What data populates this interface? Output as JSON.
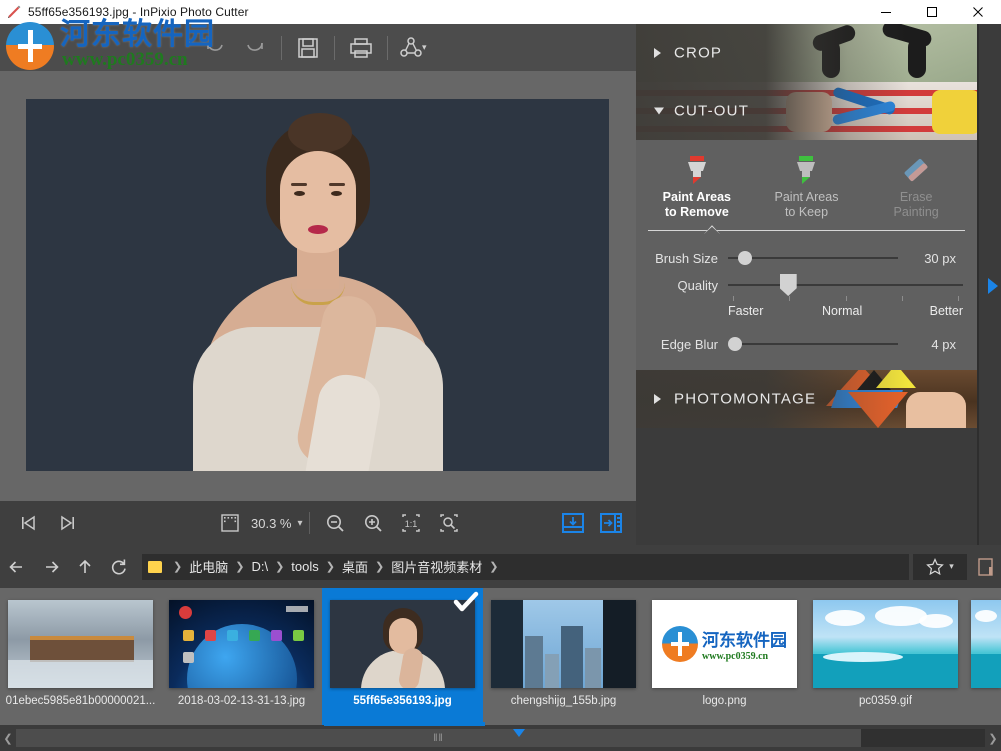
{
  "window": {
    "title": "55ff65e356193.jpg - InPixio Photo Cutter",
    "app_icon": "pencil-icon",
    "minimize": "—",
    "maximize": "□",
    "close": "✕"
  },
  "watermark": {
    "cn_text": "河东软件园",
    "url_text": "www.pc0359.cn"
  },
  "toolbar": {
    "items": [
      {
        "name": "undo-button",
        "label": "Undo",
        "icon": "undo-arrow-icon",
        "disabled": true
      },
      {
        "name": "redo-button",
        "label": "Redo",
        "icon": "redo-arrow-icon",
        "disabled": true
      },
      {
        "name": "save-button",
        "label": "Save",
        "icon": "floppy-disk-icon",
        "disabled": false
      },
      {
        "name": "print-button",
        "label": "Print",
        "icon": "printer-icon",
        "disabled": false
      },
      {
        "name": "share-button",
        "label": "Share",
        "icon": "share-nodes-icon",
        "disabled": false
      }
    ]
  },
  "canvas_toolbar": {
    "first_image_label": "First image",
    "next_image_label": "Next image",
    "fit_label": "Fit to window",
    "zoom_value": "30.3 %",
    "zoom_dropdown_caret": "▾",
    "zoom_out_label": "Zoom out",
    "zoom_in_label": "Zoom in",
    "actual_size_label": "1:1",
    "zoom_selection_label": "Zoom to selection",
    "export_label": "Export image",
    "compare_label": "Side by side compare"
  },
  "right_panel": {
    "sections": [
      {
        "id": "crop",
        "title": "CROP",
        "expanded": false,
        "arrow": "chevron-right-icon"
      },
      {
        "id": "cutout",
        "title": "CUT-OUT",
        "expanded": true,
        "arrow": "chevron-down-icon"
      },
      {
        "id": "photomontage",
        "title": "PHOTOMONTAGE",
        "expanded": false,
        "arrow": "chevron-right-icon"
      }
    ],
    "cutout": {
      "tools": [
        {
          "id": "paint-remove",
          "line1": "Paint Areas",
          "line2": "to Remove",
          "state": "active",
          "icon": "marker-red-icon"
        },
        {
          "id": "paint-keep",
          "line1": "Paint Areas",
          "line2": "to Keep",
          "state": "normal",
          "icon": "marker-green-icon"
        },
        {
          "id": "erase-painting",
          "line1": "Erase",
          "line2": "Painting",
          "state": "disabled",
          "icon": "eraser-icon"
        }
      ],
      "sliders": [
        {
          "id": "brush-size",
          "label": "Brush Size",
          "value": "30 px",
          "percent": 8,
          "style": "round"
        },
        {
          "id": "quality",
          "label": "Quality",
          "value": "",
          "percent": 24,
          "style": "pentagon"
        },
        {
          "id": "edge-blur",
          "label": "Edge Blur",
          "value": "4 px",
          "percent": 2,
          "style": "round"
        }
      ],
      "quality_ticks": [
        {
          "label": "Faster",
          "percent": 2
        },
        {
          "label": "",
          "percent": 26
        },
        {
          "label": "Normal",
          "percent": 50
        },
        {
          "label": "",
          "percent": 74
        },
        {
          "label": "Better",
          "percent": 98
        }
      ]
    },
    "expand_arrow": "triangle-right-icon"
  },
  "navbar": {
    "back_icon": "arrow-left-icon",
    "forward_icon": "arrow-right-icon",
    "up_icon": "arrow-up-icon",
    "refresh_icon": "refresh-icon",
    "folder_icon": "folder-icon",
    "breadcrumbs": [
      "此电脑",
      "D:\\",
      "tools",
      "桌面",
      "图片音视频素材"
    ],
    "separator": "❯",
    "star_icon": "star-icon",
    "star_caret": "▾",
    "preview_icon": "preview-pane-icon"
  },
  "filmstrip": {
    "items": [
      {
        "name": "01ebec5985e81b00000021...",
        "art": "snow",
        "selected": false
      },
      {
        "name": "2018-03-02-13-31-13.jpg",
        "art": "android",
        "selected": false
      },
      {
        "name": "55ff65e356193.jpg",
        "art": "portrait",
        "selected": true,
        "check": "✓"
      },
      {
        "name": "chengshijg_155b.jpg",
        "art": "city",
        "selected": false
      },
      {
        "name": "logo.png",
        "art": "logo",
        "selected": false
      },
      {
        "name": "pc0359.gif",
        "art": "sea",
        "selected": false
      },
      {
        "name": "",
        "art": "sea",
        "selected": false
      }
    ]
  },
  "scrollbar": {
    "left_arrow": "❮",
    "right_arrow": "❯",
    "grip": "‖‖"
  },
  "colors": {
    "accent_blue": "#1b84e7",
    "selection_blue": "#0a7ad6",
    "panel_gray": "#606060",
    "canvas_gray": "#676767",
    "chrome_gray": "#3f3f3f",
    "toolbar_gray": "#4c4c4c",
    "marker_red": "#e03a2f",
    "marker_green": "#3fc03f"
  }
}
